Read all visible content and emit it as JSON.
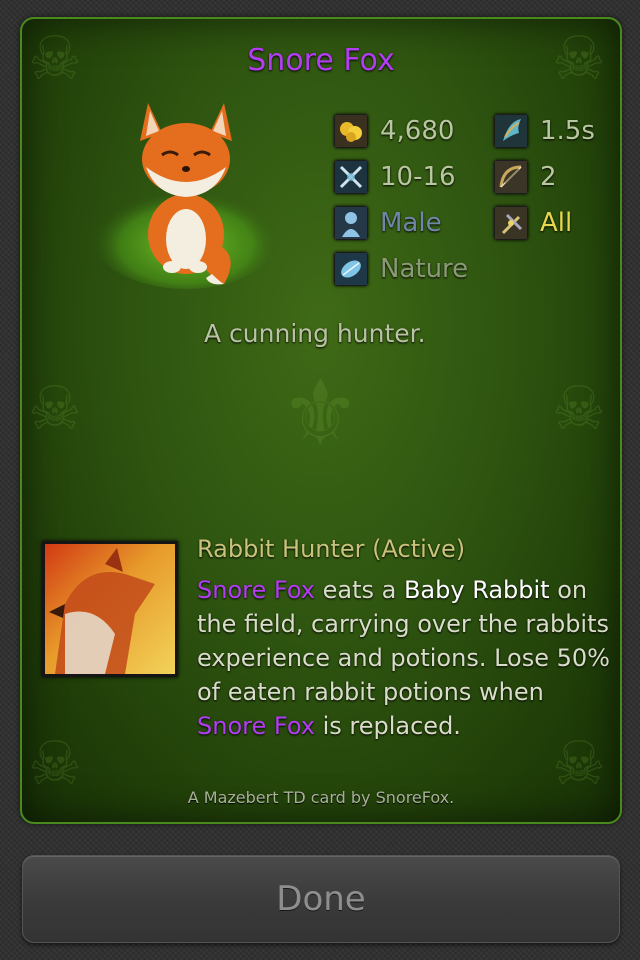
{
  "card": {
    "name": "Snore Fox",
    "stats": {
      "gold": "4,680",
      "attack_speed": "1.5s",
      "damage": "10-16",
      "range": "2",
      "gender": "Male",
      "target": "All",
      "element": "Nature"
    },
    "flavor": "A cunning hunter.",
    "ability": {
      "title": "Rabbit Hunter (Active)",
      "text_1": "Snore Fox",
      "text_2": " eats a ",
      "text_3": "Baby Rabbit",
      "text_4": " on the field, carrying over the rabbits experience and potions. Lose 50% of eaten rabbit potions when ",
      "text_5": "Snore Fox",
      "text_6": " is replaced."
    },
    "credit": "A Mazebert TD card by SnoreFox."
  },
  "icons": {
    "gold": "gold-coins-icon",
    "attack_speed": "speed-icon",
    "damage": "crossed-swords-icon",
    "range": "bow-icon",
    "gender": "gender-icon",
    "target": "target-icon",
    "element": "nature-element-icon"
  },
  "colors": {
    "name": "#b23cf2",
    "male": "#6f86a6",
    "all": "#e6d84a",
    "ability_title": "#c9c27b"
  },
  "done_button": {
    "label": "Done"
  }
}
